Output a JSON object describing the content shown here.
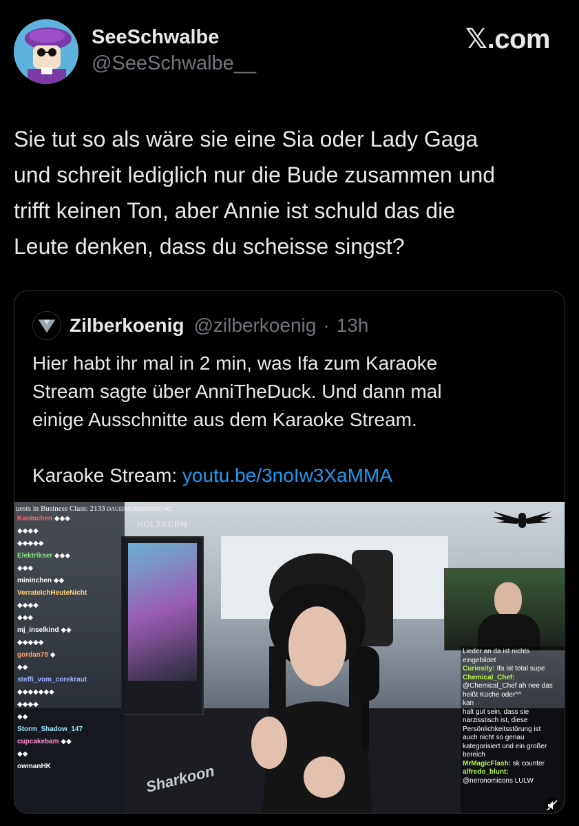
{
  "author": {
    "display_name": "SeeSchwalbe",
    "handle": "@SeeSchwalbe__",
    "avatar_icon": "avatar-purple-beret-icon"
  },
  "brand": "𝕏.com",
  "tweet": {
    "lines": [
      "Sie tut so als wäre sie eine Sia oder Lady Gaga",
      "und schreit lediglich nur die Bude zusammen und",
      "trifft keinen Ton, aber Annie ist schuld das die",
      "Leute denken, dass du scheisse singst?"
    ]
  },
  "quote": {
    "name": "Zilberkoenig",
    "handle": "@zilberkoenig",
    "dot": "·",
    "time": "13h",
    "body_lines": [
      "Hier habt ihr mal in 2 min, was Ifa zum Karaoke",
      "Stream sagte über AnniTheDuck. Und dann mal",
      "einige Ausschnitte aus dem Karaoke Stream."
    ],
    "link_prefix": "Karaoke Stream: ",
    "link_text": "youtu.be/3noIw3XaMMA"
  },
  "media": {
    "chat_title": "uests in Business Class: 2133",
    "chat_subtitle": "DAUERWERBESENDUNG",
    "sponsor": "HOLZKERN",
    "watermark": "Sharkoon",
    "chat_rows": [
      {
        "user": "Kaninchen"
      },
      {
        "user": "Elektrikser"
      },
      {
        "user": "mininchen"
      },
      {
        "user": "VerrateIchHeuteNicht"
      },
      {
        "user": "mj_inselkind"
      },
      {
        "user": "gordan78"
      },
      {
        "user": "steffi_vom_corekraut"
      },
      {
        "user": "Storm_Shadow_147"
      },
      {
        "user": "cupcakebam"
      },
      {
        "user": "owmanHK"
      }
    ],
    "overlay_chat": [
      {
        "name": "",
        "text": "Lieder an da ist nichts"
      },
      {
        "name": "",
        "text": "eingebildet"
      },
      {
        "name": "Curiosity:",
        "text": " Ifa ist total supe"
      },
      {
        "name": "Chemical_Chef:",
        "text": ""
      },
      {
        "name": "",
        "text": "@Chemical_Chef ah nee das"
      },
      {
        "name": "",
        "text": "heißt Küche oder^^"
      },
      {
        "name": "",
        "text": "kan"
      },
      {
        "name": "",
        "text": "halt gut sein, dass sie"
      },
      {
        "name": "",
        "text": "narzisstisch ist, diese"
      },
      {
        "name": "",
        "text": "Persönlichkeitsstörung ist"
      },
      {
        "name": "",
        "text": "auch nicht so genau"
      },
      {
        "name": "",
        "text": "kategorisiert und ein großer"
      },
      {
        "name": "",
        "text": "bereich"
      },
      {
        "name": "MrMagicFlash:",
        "text": " sk counter"
      },
      {
        "name": "alfredo_blunt:",
        "text": ""
      },
      {
        "name": "",
        "text": "@neronomicons LULW"
      }
    ],
    "mute_icon": "muted-speaker-icon"
  }
}
